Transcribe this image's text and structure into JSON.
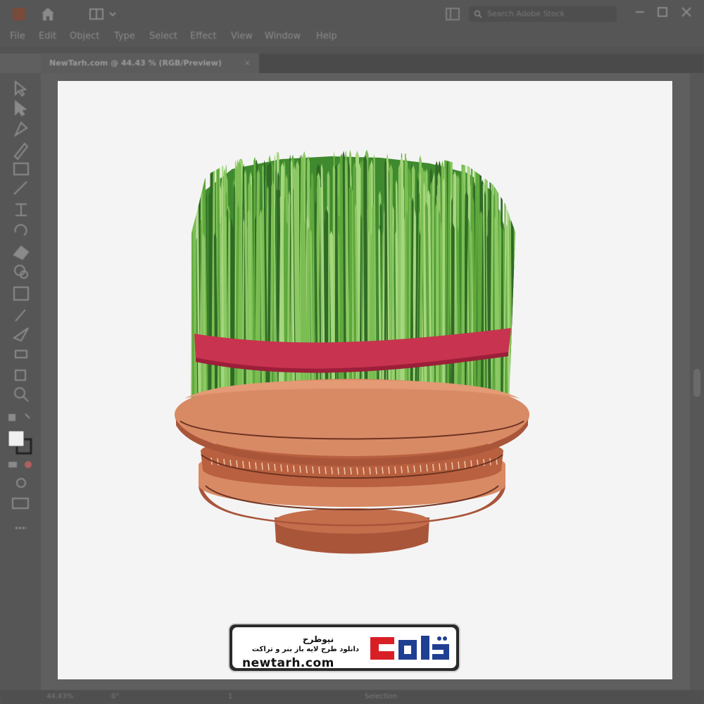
{
  "menu": {
    "items": [
      "File",
      "Edit",
      "Object",
      "Type",
      "Select",
      "Effect",
      "View",
      "Window",
      "Help"
    ]
  },
  "search": {
    "placeholder": "Search Adobe Stock"
  },
  "document_tab": {
    "label": "NewTarh.com @ 44.43 % (RGB/Preview)",
    "close": "×"
  },
  "status": {
    "zoom": "44.43%",
    "angle": "0°",
    "artboard": "1",
    "mode": "Selection"
  },
  "watermark": {
    "name_fa": "نیوطرح",
    "tagline_fa": "دانلود طرح لایه باز بنر و تراکت",
    "url": "newtarh.com",
    "logo_text": "نیوطرح"
  },
  "colors": {
    "grass_light": "#8cc864",
    "grass_mid": "#5ea83c",
    "grass_dark": "#2f6a25",
    "ribbon": "#c8334f",
    "pot_main": "#d88a65",
    "pot_dark": "#a9553a",
    "pot_line": "#6e3322",
    "logo_red": "#d91f26",
    "logo_blue": "#1f3f93"
  }
}
